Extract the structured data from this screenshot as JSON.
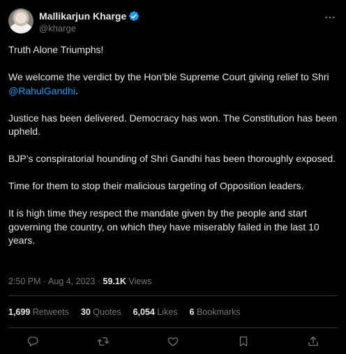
{
  "author": {
    "display_name": "Mallikarjun Kharge",
    "handle": "@kharge"
  },
  "tweet": {
    "paragraphs": [
      {
        "pre": "Truth Alone Triumphs!",
        "mention": "",
        "post": ""
      },
      {
        "pre": "We welcome the verdict by the Hon’ble Supreme Court giving relief to Shri ",
        "mention": "@RahulGandhi",
        "post": "."
      },
      {
        "pre": "Justice has been delivered. Democracy has won. The Constitution has been upheld.",
        "mention": "",
        "post": ""
      },
      {
        "pre": "BJP’s conspiratorial hounding of Shri Gandhi has been thoroughly exposed.",
        "mention": "",
        "post": ""
      },
      {
        "pre": "Time for them to stop their malicious targeting of Opposition leaders.",
        "mention": "",
        "post": ""
      },
      {
        "pre": "It is high time they respect the mandate given by the people and start governing the country, on which they have miserably failed in the last 10 years.",
        "mention": "",
        "post": ""
      }
    ]
  },
  "meta": {
    "time": "2:50 PM",
    "separator": " · ",
    "date": "Aug 4, 2023",
    "views_count": "59.1K",
    "views_label": "Views"
  },
  "stats": {
    "retweets_count": "1,699",
    "retweets_label": "Retweets",
    "quotes_count": "30",
    "quotes_label": "Quotes",
    "likes_count": "6,054",
    "likes_label": "Likes",
    "bookmarks_count": "6",
    "bookmarks_label": "Bookmarks"
  },
  "icons": {
    "verified": "verified-badge-icon",
    "more": "more-icon",
    "reply": "reply-icon",
    "retweet": "retweet-icon",
    "like": "heart-icon",
    "bookmark": "bookmark-icon",
    "share": "share-icon"
  },
  "colors": {
    "background": "#000000",
    "text": "#e7e9ea",
    "secondary": "#71767b",
    "accent": "#1d9bf0",
    "divider": "#2f3336"
  }
}
